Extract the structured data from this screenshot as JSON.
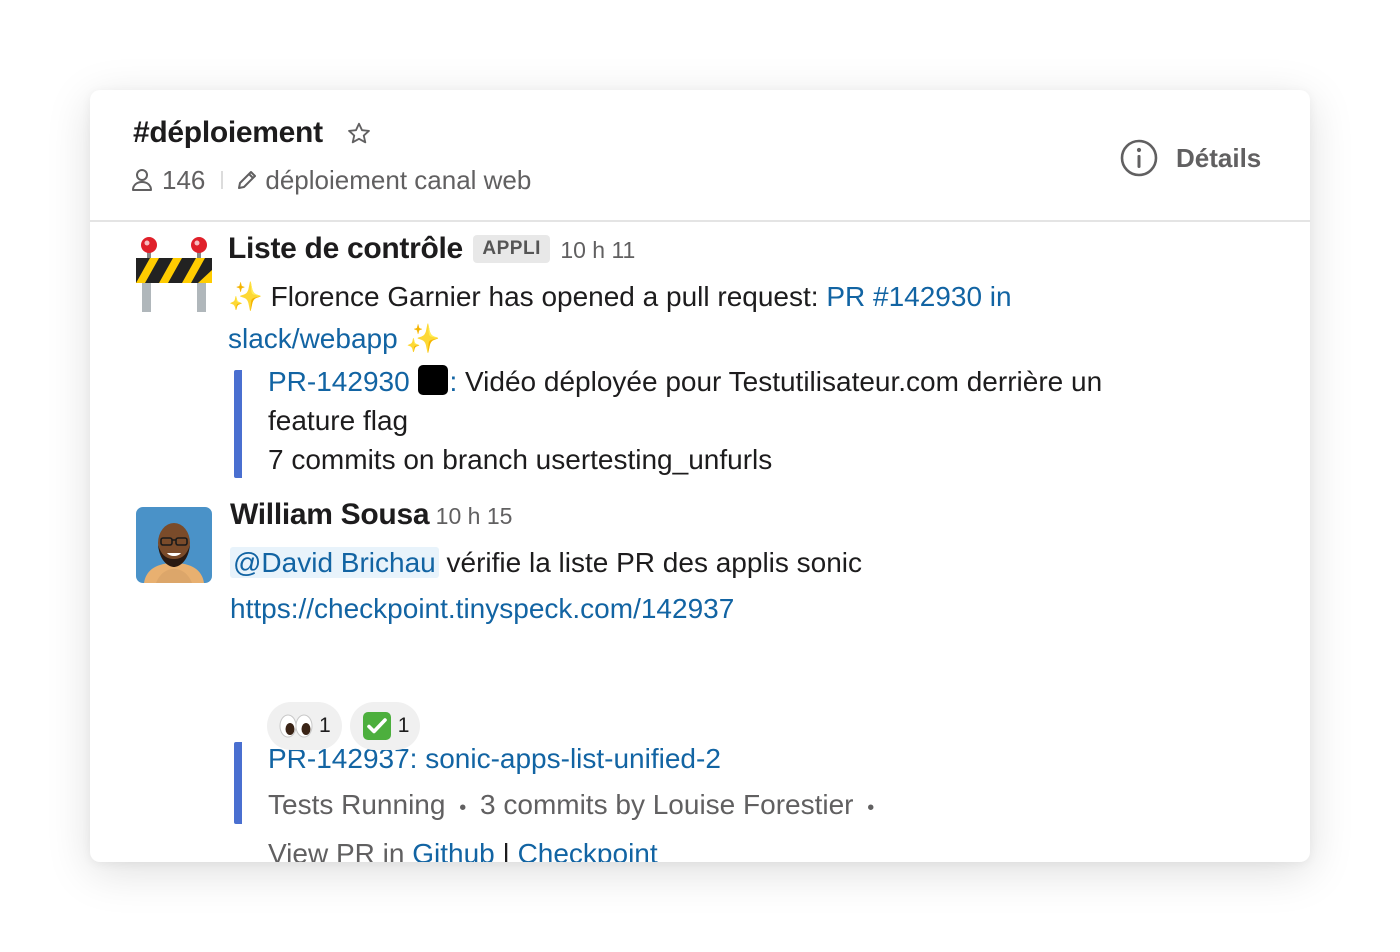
{
  "channel": {
    "name": "#déploiement",
    "member_count": "146",
    "topic": "déploiement canal web",
    "details_label": "Détails"
  },
  "messages": [
    {
      "author": "Liste de contrôle",
      "badge": "APPLI",
      "time": "10 h 11",
      "text_prefix": " Florence Garnier has opened a pull request: ",
      "link_text": "PR #142930 in slack/webapp",
      "attachment": {
        "link": "PR-142930",
        "colon": ":",
        "title": " Vidéo déployée pour Testutilisateur.com derrière un feature flag",
        "subtitle": "7 commits on branch usertesting_unfurls"
      }
    },
    {
      "author": "William Sousa",
      "time": "10 h 15",
      "mention": "@David Brichau",
      "text": " vérifie la liste PR des applis sonic",
      "url": "https://checkpoint.tinyspeck.com/142937",
      "attachment": {
        "title": "PR-142937: sonic-apps-list-unified-2",
        "status": "Tests Running",
        "commits": "3 commits by",
        "commit_author": "Louise Forestier",
        "view_prefix": "View PR in ",
        "github": "Github",
        "pipe": " | ",
        "checkpoint": "Checkpoint"
      },
      "reactions": [
        {
          "emoji": "👀",
          "count": "1"
        },
        {
          "emoji": "✅",
          "count": "1"
        }
      ]
    }
  ],
  "colors": {
    "link": "#1264a3",
    "attachment_bar": "#4a6fd0",
    "text": "#1d1c1d",
    "muted": "#616061"
  }
}
